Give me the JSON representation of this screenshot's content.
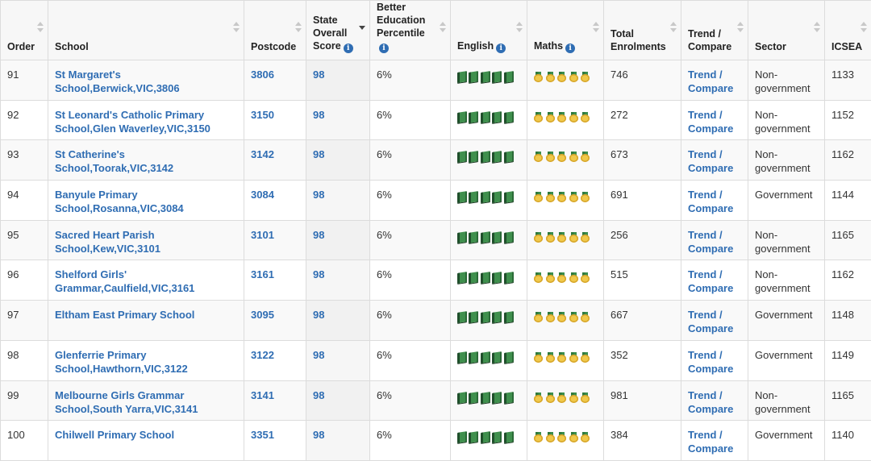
{
  "headers": {
    "order": "Order",
    "school": "School",
    "postcode": "Postcode",
    "state_score": "State Overall Score",
    "percentile": "Better Education Percentile",
    "english": "English",
    "maths": "Maths",
    "enrolments": "Total Enrolments",
    "trend": "Trend / Compare",
    "sector": "Sector",
    "icsea": "ICSEA"
  },
  "colors": {
    "link": "#2f6db3",
    "header_bg": "#f7f7f7",
    "info_icon": "#2f6db3"
  },
  "icons": {
    "info": "info-icon",
    "english": "book-icon",
    "maths": "medal-icon"
  },
  "rows": [
    {
      "order": "91",
      "school": "St Margaret's School,Berwick,VIC,3806",
      "postcode": "3806",
      "score": "98",
      "percentile": "6%",
      "english_books": 5,
      "maths_medals": 5,
      "enrolments": "746",
      "trend": "Trend / Compare",
      "sector": "Non-government",
      "icsea": "1133"
    },
    {
      "order": "92",
      "school": "St Leonard's Catholic Primary School,Glen Waverley,VIC,3150",
      "postcode": "3150",
      "score": "98",
      "percentile": "6%",
      "english_books": 5,
      "maths_medals": 5,
      "enrolments": "272",
      "trend": "Trend / Compare",
      "sector": "Non-government",
      "icsea": "1152"
    },
    {
      "order": "93",
      "school": "St Catherine's School,Toorak,VIC,3142",
      "postcode": "3142",
      "score": "98",
      "percentile": "6%",
      "english_books": 5,
      "maths_medals": 5,
      "enrolments": "673",
      "trend": "Trend / Compare",
      "sector": "Non-government",
      "icsea": "1162"
    },
    {
      "order": "94",
      "school": "Banyule Primary School,Rosanna,VIC,3084",
      "postcode": "3084",
      "score": "98",
      "percentile": "6%",
      "english_books": 5,
      "maths_medals": 5,
      "enrolments": "691",
      "trend": "Trend / Compare",
      "sector": "Government",
      "icsea": "1144"
    },
    {
      "order": "95",
      "school": "Sacred Heart Parish School,Kew,VIC,3101",
      "postcode": "3101",
      "score": "98",
      "percentile": "6%",
      "english_books": 5,
      "maths_medals": 5,
      "enrolments": "256",
      "trend": "Trend / Compare",
      "sector": "Non-government",
      "icsea": "1165"
    },
    {
      "order": "96",
      "school": "Shelford Girls' Grammar,Caulfield,VIC,3161",
      "postcode": "3161",
      "score": "98",
      "percentile": "6%",
      "english_books": 5,
      "maths_medals": 5,
      "enrolments": "515",
      "trend": "Trend / Compare",
      "sector": "Non-government",
      "icsea": "1162"
    },
    {
      "order": "97",
      "school": "Eltham East Primary School",
      "postcode": "3095",
      "score": "98",
      "percentile": "6%",
      "english_books": 5,
      "maths_medals": 5,
      "enrolments": "667",
      "trend": "Trend / Compare",
      "sector": "Government",
      "icsea": "1148"
    },
    {
      "order": "98",
      "school": "Glenferrie Primary School,Hawthorn,VIC,3122",
      "postcode": "3122",
      "score": "98",
      "percentile": "6%",
      "english_books": 5,
      "maths_medals": 5,
      "enrolments": "352",
      "trend": "Trend / Compare",
      "sector": "Government",
      "icsea": "1149"
    },
    {
      "order": "99",
      "school": "Melbourne Girls Grammar School,South Yarra,VIC,3141",
      "postcode": "3141",
      "score": "98",
      "percentile": "6%",
      "english_books": 5,
      "maths_medals": 5,
      "enrolments": "981",
      "trend": "Trend / Compare",
      "sector": "Non-government",
      "icsea": "1165"
    },
    {
      "order": "100",
      "school": "Chilwell Primary School",
      "postcode": "3351",
      "score": "98",
      "percentile": "6%",
      "english_books": 5,
      "maths_medals": 5,
      "enrolments": "384",
      "trend": "Trend / Compare",
      "sector": "Government",
      "icsea": "1140"
    }
  ]
}
